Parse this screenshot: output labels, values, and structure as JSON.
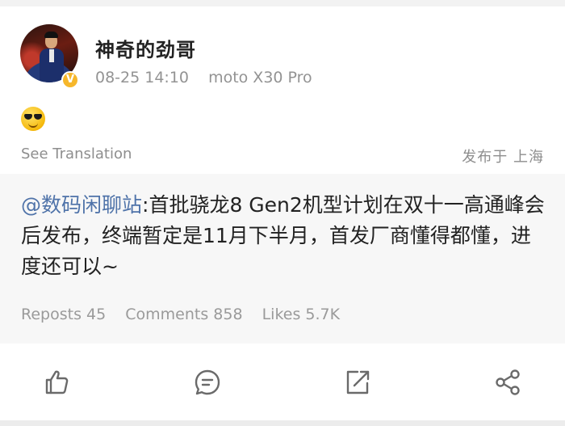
{
  "post": {
    "username": "神奇的劲哥",
    "timestamp": "08-25 14:10",
    "device": "moto X30 Pro",
    "emoji": "sunglasses-emoji",
    "verified_badge": "V",
    "see_translation": "See Translation",
    "location": "发布于 上海"
  },
  "repost": {
    "mention": "@数码闲聊站",
    "text": ":首批骁龙8 Gen2机型计划在双十一高通峰会后发布，终端暂定是11月下半月，首发厂商懂得都懂，进度还可以~",
    "stats": {
      "reposts": "Reposts 45",
      "comments": "Comments 858",
      "likes": "Likes 5.7K"
    }
  },
  "actions": [
    {
      "icon": "like-icon"
    },
    {
      "icon": "comment-icon"
    },
    {
      "icon": "repost-icon"
    },
    {
      "icon": "share-icon"
    }
  ],
  "colors": {
    "mention": "#4f73a9",
    "muted_text": "#939393",
    "verified": "#f6b72b"
  }
}
